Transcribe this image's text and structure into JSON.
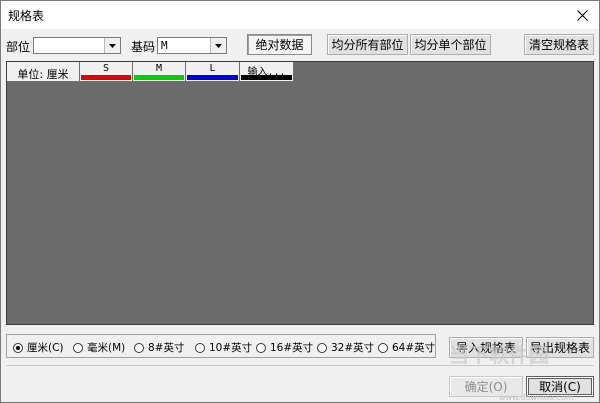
{
  "window": {
    "title": "规格表"
  },
  "toolbar": {
    "part_label": "部位",
    "part_value": "",
    "base_size_label": "基码",
    "base_size_value": "M",
    "absolute_data_label": "绝对数据",
    "split_all_label": "均分所有部位",
    "split_single_label": "均分单个部位",
    "clear_label": "清空规格表"
  },
  "grid": {
    "unit_header": "单位: 厘米",
    "columns": [
      {
        "label": "S",
        "color": "#e00000"
      },
      {
        "label": "M",
        "color": "#00d000"
      },
      {
        "label": "L",
        "color": "#0000e0"
      },
      {
        "label": "输入...",
        "color": "#000000"
      }
    ],
    "background": "#6b6b6b"
  },
  "units": {
    "options": [
      "厘米(C)",
      "毫米(M)",
      "8#英寸",
      "10#英寸",
      "16#英寸",
      "32#英寸",
      "64#英寸"
    ],
    "selected": "厘米(C)"
  },
  "actions": {
    "import_label": "导入规格表",
    "export_label": "导出规格表",
    "ok_label": "确定(O)",
    "cancel_label": "取消(C)"
  },
  "watermark": {
    "text": "当下软件园",
    "url": "www.downxia.com"
  }
}
